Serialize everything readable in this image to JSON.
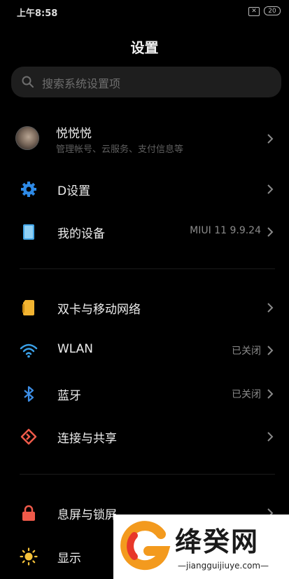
{
  "status_bar": {
    "time": "上午8:58",
    "sim_indicator": "✕",
    "battery": "20"
  },
  "page_title": "设置",
  "search": {
    "placeholder": "搜索系统设置项"
  },
  "account": {
    "name": "悦悦悦",
    "subtitle": "管理帐号、云服务、支付信息等"
  },
  "items": [
    {
      "label": "D设置",
      "value": "",
      "icon": "gear-icon",
      "color": "#2e8ae6"
    },
    {
      "label": "我的设备",
      "value": "MIUI 11 9.9.24",
      "icon": "device-icon",
      "color": "#43a6e8"
    },
    {
      "label": "双卡与移动网络",
      "value": "",
      "icon": "sim-card-icon",
      "color": "#f2b431"
    },
    {
      "label": "WLAN",
      "value": "已关闭",
      "icon": "wifi-icon",
      "color": "#3aa0e8"
    },
    {
      "label": "蓝牙",
      "value": "已关闭",
      "icon": "bluetooth-icon",
      "color": "#3d8ee6"
    },
    {
      "label": "连接与共享",
      "value": "",
      "icon": "share-icon",
      "color": "#ef5a4a"
    },
    {
      "label": "息屏与锁屏",
      "value": "",
      "icon": "lock-icon",
      "color": "#ef5a4a"
    },
    {
      "label": "显示",
      "value": "",
      "icon": "sun-icon",
      "color": "#f5c23a"
    }
  ],
  "watermark": {
    "text": "绛癸网",
    "url": "—jiangguijiuye.com—"
  }
}
